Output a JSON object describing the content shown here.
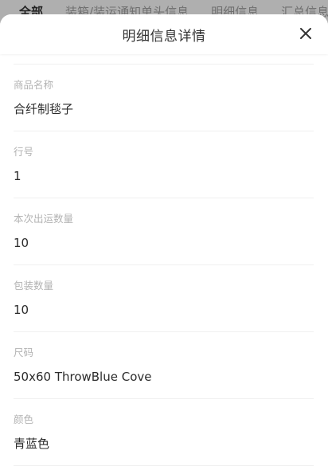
{
  "background_tabs": [
    "全部",
    "装箱/装运通知单头信息",
    "明细信息",
    "汇总信息"
  ],
  "sheet": {
    "title": "明细信息详情",
    "close_icon": "close-icon"
  },
  "fields": [
    {
      "label": "商品名称",
      "value": "合纤制毯子"
    },
    {
      "label": "行号",
      "value": "1"
    },
    {
      "label": "本次出运数量",
      "value": "10"
    },
    {
      "label": "包装数量",
      "value": "10"
    },
    {
      "label": "尺码",
      "value": "50x60 ThrowBlue Cove"
    },
    {
      "label": "颜色",
      "value": "青蓝色"
    }
  ],
  "colors": {
    "title": "#333333",
    "label": "#b3b3b3",
    "value": "#2b2b2b",
    "divider": "#f0f0f0"
  }
}
